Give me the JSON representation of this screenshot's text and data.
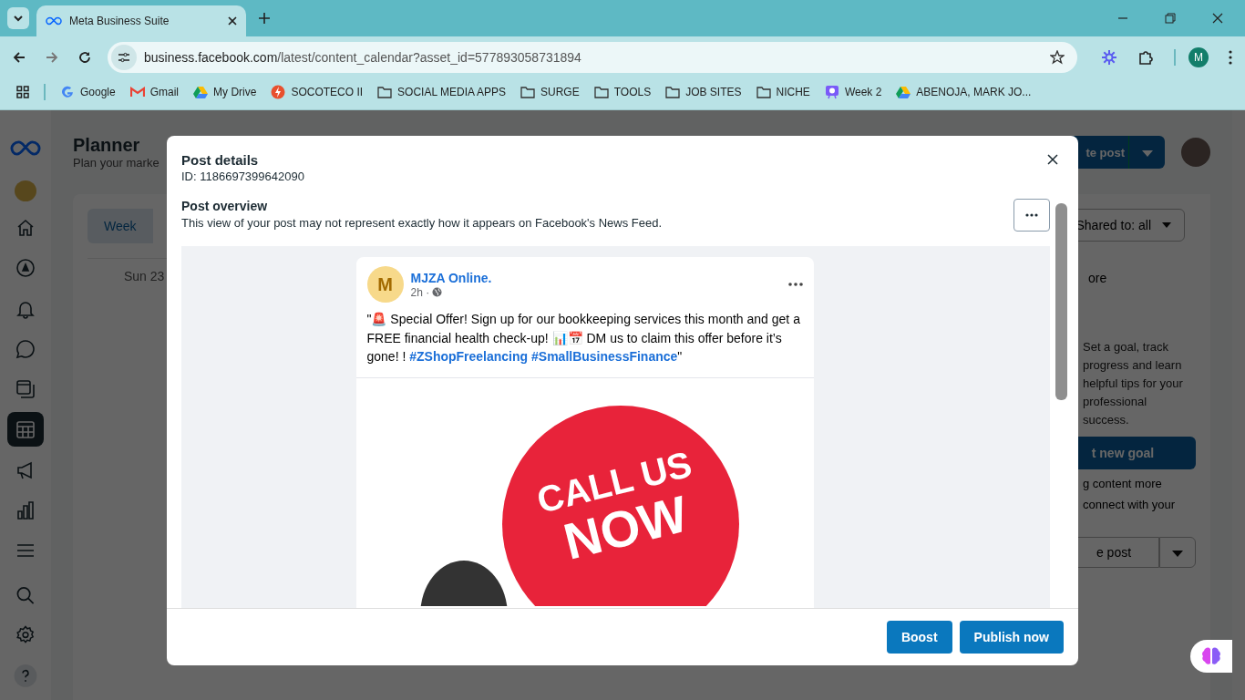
{
  "browser": {
    "tabs": [
      {
        "title": "Meta Business Suite",
        "selected": true
      }
    ],
    "url": {
      "host": "business.facebook.com",
      "path": "/latest/content_calendar?asset_id=577893058731894"
    },
    "profile": "M",
    "bookmarks": [
      {
        "label": "Google",
        "kind": "google"
      },
      {
        "label": "Gmail",
        "kind": "gmail"
      },
      {
        "label": "My Drive",
        "kind": "drive"
      },
      {
        "label": "SOCOTECO II",
        "kind": "bolt"
      },
      {
        "label": "SOCIAL MEDIA APPS",
        "kind": "folder"
      },
      {
        "label": "SURGE",
        "kind": "folder"
      },
      {
        "label": "TOOLS",
        "kind": "folder"
      },
      {
        "label": "JOB SITES",
        "kind": "folder"
      },
      {
        "label": "NICHE",
        "kind": "folder"
      },
      {
        "label": "Week 2",
        "kind": "slides"
      },
      {
        "label": "ABENOJA, MARK JO...",
        "kind": "drive"
      }
    ]
  },
  "sidebar": [
    {
      "kind": "home",
      "selected": false
    },
    {
      "kind": "compass",
      "selected": false
    },
    {
      "kind": "bell",
      "selected": false
    },
    {
      "kind": "chat",
      "selected": false
    },
    {
      "kind": "pages",
      "selected": false
    },
    {
      "kind": "calendar",
      "selected": true
    },
    {
      "kind": "megaphone",
      "selected": false
    },
    {
      "kind": "chart",
      "selected": false
    },
    {
      "kind": "menu",
      "selected": false
    }
  ],
  "sidebar_bottom": [
    {
      "kind": "search"
    },
    {
      "kind": "settings"
    },
    {
      "kind": "help"
    }
  ],
  "planner": {
    "title": "Planner",
    "subtitle": "Plan your marke",
    "view_tabs": [
      {
        "label": "Week",
        "selected": true
      }
    ],
    "day": "Sun 23",
    "create_button": "te post",
    "shared_filter": "Shared to: all",
    "more": "ore",
    "goal_text": "Set a goal, track progress and learn helpful tips for your professional success.",
    "goal_button": "t new goal",
    "promo_lines": [
      "g content more",
      "connect with your"
    ],
    "post_button": "e post"
  },
  "modal": {
    "title": "Post details",
    "id": "ID: 1186697399642090",
    "section_title": "Post overview",
    "section_note": "This view of your post may not represent exactly how it appears on Facebook's News Feed.",
    "post": {
      "avatar": "M",
      "page": "MJZA Online.",
      "time": "2h ·",
      "text": [
        {
          "kind": "text",
          "text": "\"🚨 Special Offer! Sign up for our bookkeeping services this month and get a FREE financial health check-up! 📊📅 DM us to claim this offer before it’s gone! ! "
        },
        {
          "kind": "hashtag",
          "text": "#ZShopFreelancing"
        },
        {
          "kind": "hashtag",
          "text": "#SmallBusinessFinance"
        },
        {
          "kind": "text",
          "text": "\""
        }
      ],
      "image_lines": [
        "CALL US",
        "NOW"
      ]
    },
    "buttons": [
      {
        "label": "Boost"
      },
      {
        "label": "Publish now"
      }
    ]
  }
}
